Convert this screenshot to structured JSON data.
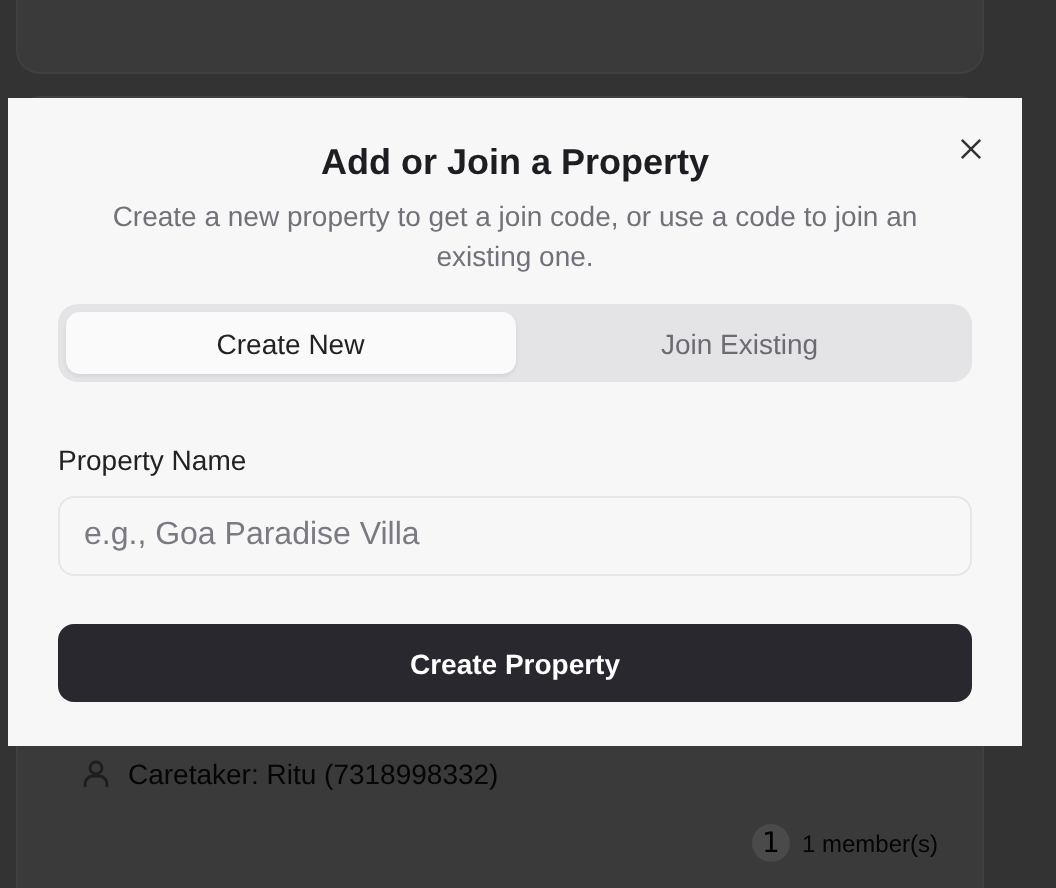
{
  "background": {
    "cards": [
      {
        "caretaker": "Caretaker: Ritu (7318998332)",
        "member_count": "1",
        "members_label": "1 member(s)"
      }
    ]
  },
  "dialog": {
    "title": "Add or Join a Property",
    "subtitle": "Create a new property to get a join code, or use a code to join an existing one.",
    "tabs": [
      {
        "label": "Create New",
        "selected": true
      },
      {
        "label": "Join Existing",
        "selected": false
      }
    ],
    "field": {
      "label": "Property Name",
      "placeholder": "e.g., Goa Paradise Villa"
    },
    "submit": "Create Property"
  }
}
